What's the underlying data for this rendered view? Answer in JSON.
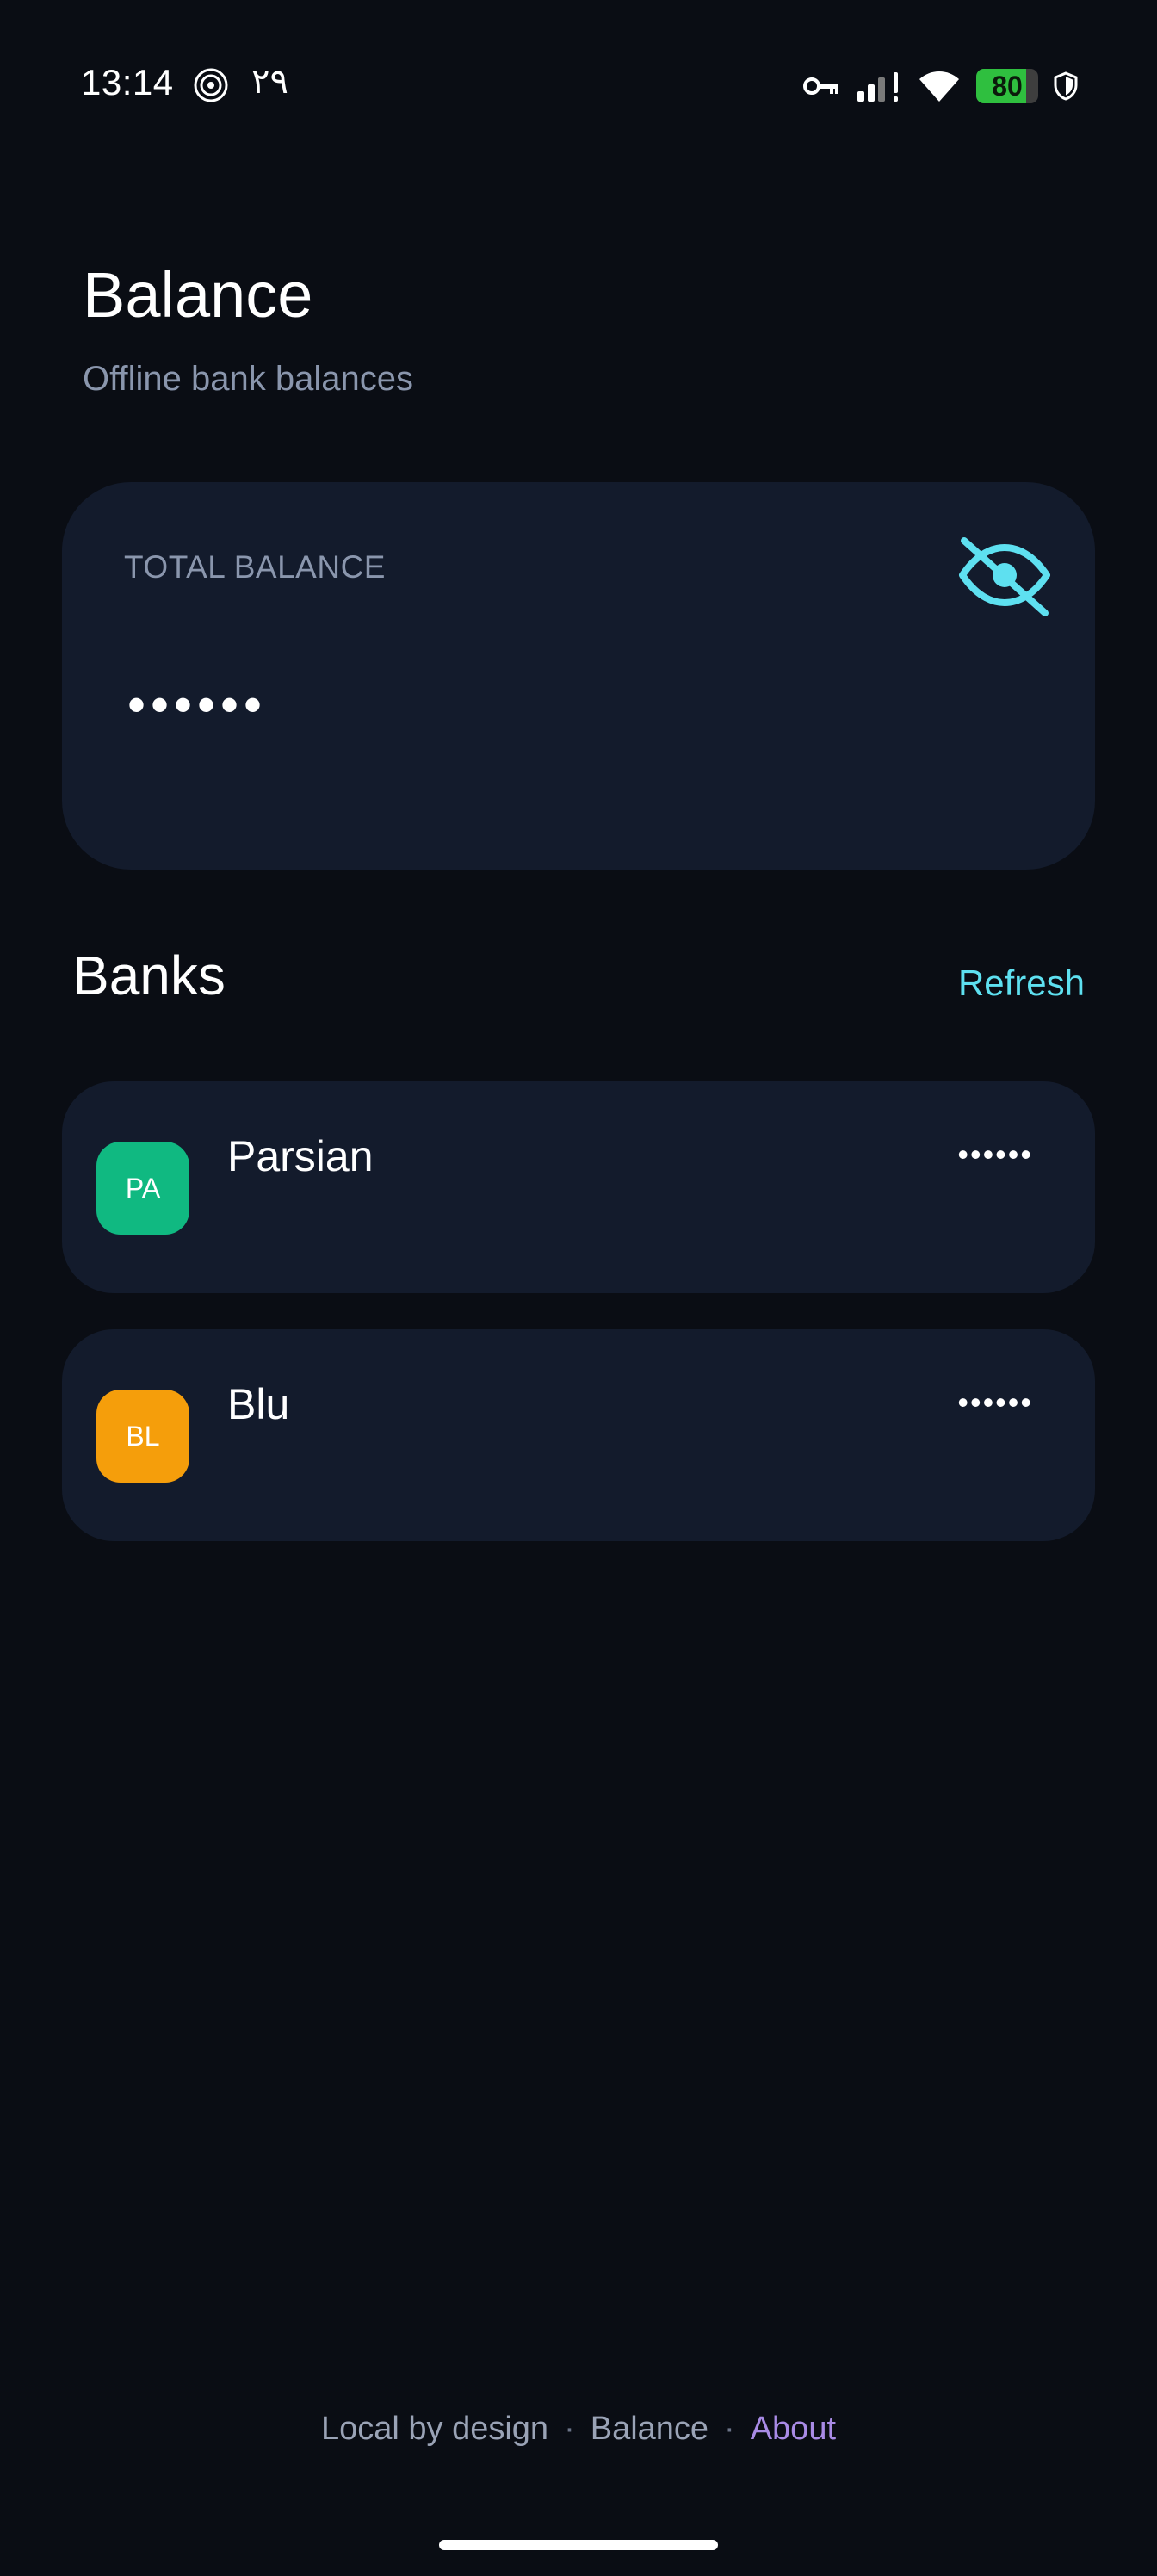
{
  "status_bar": {
    "time": "13:14",
    "date": "۲۹",
    "battery_level": 80,
    "battery_text": "80",
    "icons": [
      "spiral-icon",
      "vpn-key-icon",
      "signal-icon",
      "wifi-icon",
      "battery-icon",
      "shield-icon"
    ]
  },
  "header": {
    "title": "Balance",
    "subtitle": "Offline bank balances"
  },
  "total_card": {
    "label": "TOTAL BALANCE",
    "value": "••••••",
    "visibility_icon": "eye-off-icon",
    "accent_color": "#5ee0f0"
  },
  "banks_section": {
    "title": "Banks",
    "refresh_label": "Refresh"
  },
  "banks": [
    {
      "initials": "PA",
      "name": "Parsian",
      "balance": "••••••",
      "color": "#10b981"
    },
    {
      "initials": "BL",
      "name": "Blu",
      "balance": "••••••",
      "color": "#f59e0b"
    }
  ],
  "footer": {
    "item1": "Local by design",
    "separator": "·",
    "item2": "Balance",
    "about_label": "About"
  }
}
